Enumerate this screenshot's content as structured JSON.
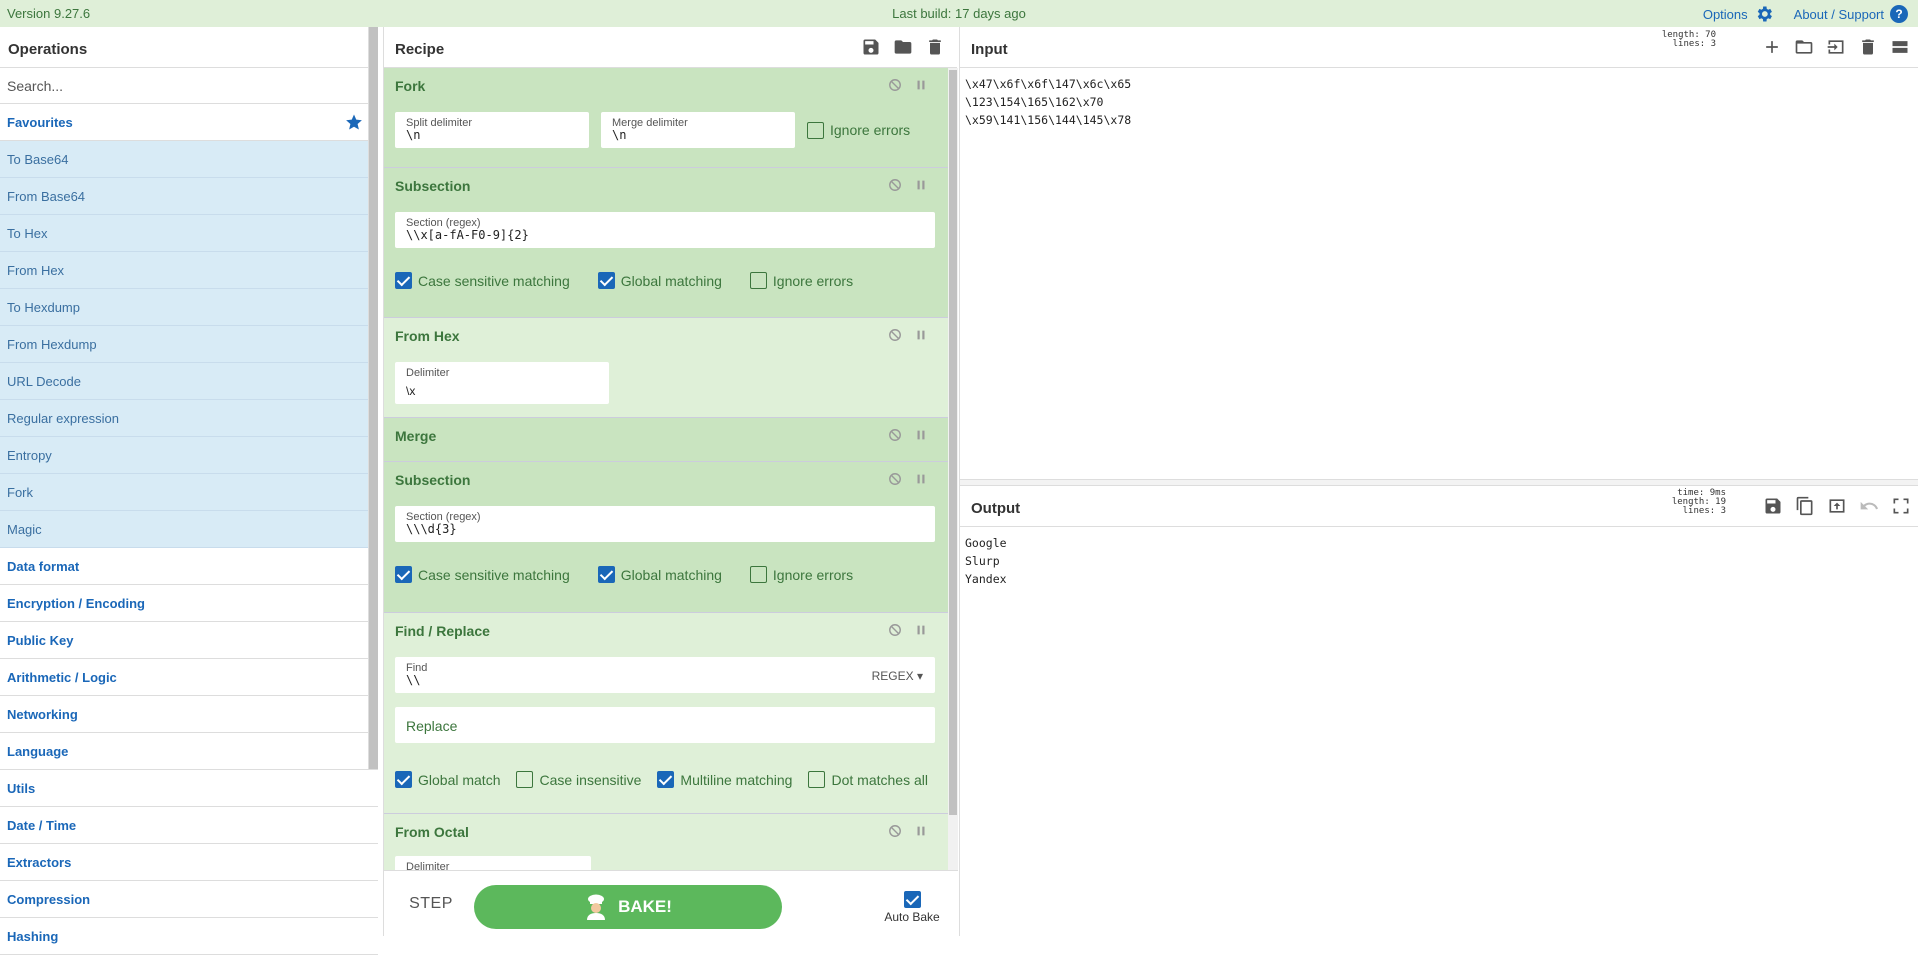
{
  "banner": {
    "version": "Version 9.27.6",
    "last_build": "Last build: 17 days ago",
    "options": "Options",
    "about": "About / Support",
    "help_glyph": "?"
  },
  "operations": {
    "title": "Operations",
    "search_placeholder": "Search...",
    "favourites_label": "Favourites",
    "favourites": [
      "To Base64",
      "From Base64",
      "To Hex",
      "From Hex",
      "To Hexdump",
      "From Hexdump",
      "URL Decode",
      "Regular expression",
      "Entropy",
      "Fork",
      "Magic"
    ],
    "categories": [
      "Data format",
      "Encryption / Encoding",
      "Public Key",
      "Arithmetic / Logic",
      "Networking",
      "Language",
      "Utils",
      "Date / Time",
      "Extractors",
      "Compression",
      "Hashing"
    ]
  },
  "recipe": {
    "title": "Recipe",
    "fork": {
      "title": "Fork",
      "split_label": "Split delimiter",
      "split_value": "\\n",
      "merge_label": "Merge delimiter",
      "merge_value": "\\n",
      "ignore_errors": "Ignore errors"
    },
    "subsection1": {
      "title": "Subsection",
      "section_label": "Section (regex)",
      "section_value": "\\\\x[a-fA-F0-9]{2}",
      "case_sensitive": "Case sensitive matching",
      "global": "Global matching",
      "ignore_errors": "Ignore errors"
    },
    "from_hex": {
      "title": "From Hex",
      "delim_label": "Delimiter",
      "delim_value": "\\x"
    },
    "merge": {
      "title": "Merge"
    },
    "subsection2": {
      "title": "Subsection",
      "section_label": "Section (regex)",
      "section_value": "\\\\\\d{3}",
      "case_sensitive": "Case sensitive matching",
      "global": "Global matching",
      "ignore_errors": "Ignore errors"
    },
    "find_replace": {
      "title": "Find / Replace",
      "find_label": "Find",
      "find_value": "\\\\",
      "regex_dd": "REGEX",
      "replace_placeholder": "Replace",
      "global_match": "Global match",
      "case_insensitive": "Case insensitive",
      "multiline": "Multiline matching",
      "dot_all": "Dot matches all"
    },
    "from_octal": {
      "title": "From Octal",
      "delim_label": "Delimiter"
    },
    "step": "STEP",
    "bake": "BAKE!",
    "auto_bake": "Auto Bake"
  },
  "input": {
    "title": "Input",
    "stats": {
      "length": "length: 70",
      "lines": "lines:  3"
    },
    "text": "\\x47\\x6f\\x6f\\147\\x6c\\x65\n\\123\\154\\165\\162\\x70\n\\x59\\141\\156\\144\\145\\x78"
  },
  "output": {
    "title": "Output",
    "stats": {
      "time": "time:  9ms",
      "length": "length:  19",
      "lines": "lines:   3"
    },
    "text": "Google\nSlurp\nYandex"
  },
  "colors": {
    "accent": "#1a67b8",
    "recipe_dark": "#c9e4c0",
    "recipe_light": "#dff0d8",
    "bake": "#5cb85c",
    "favourite_bg": "#d8ebf6"
  }
}
